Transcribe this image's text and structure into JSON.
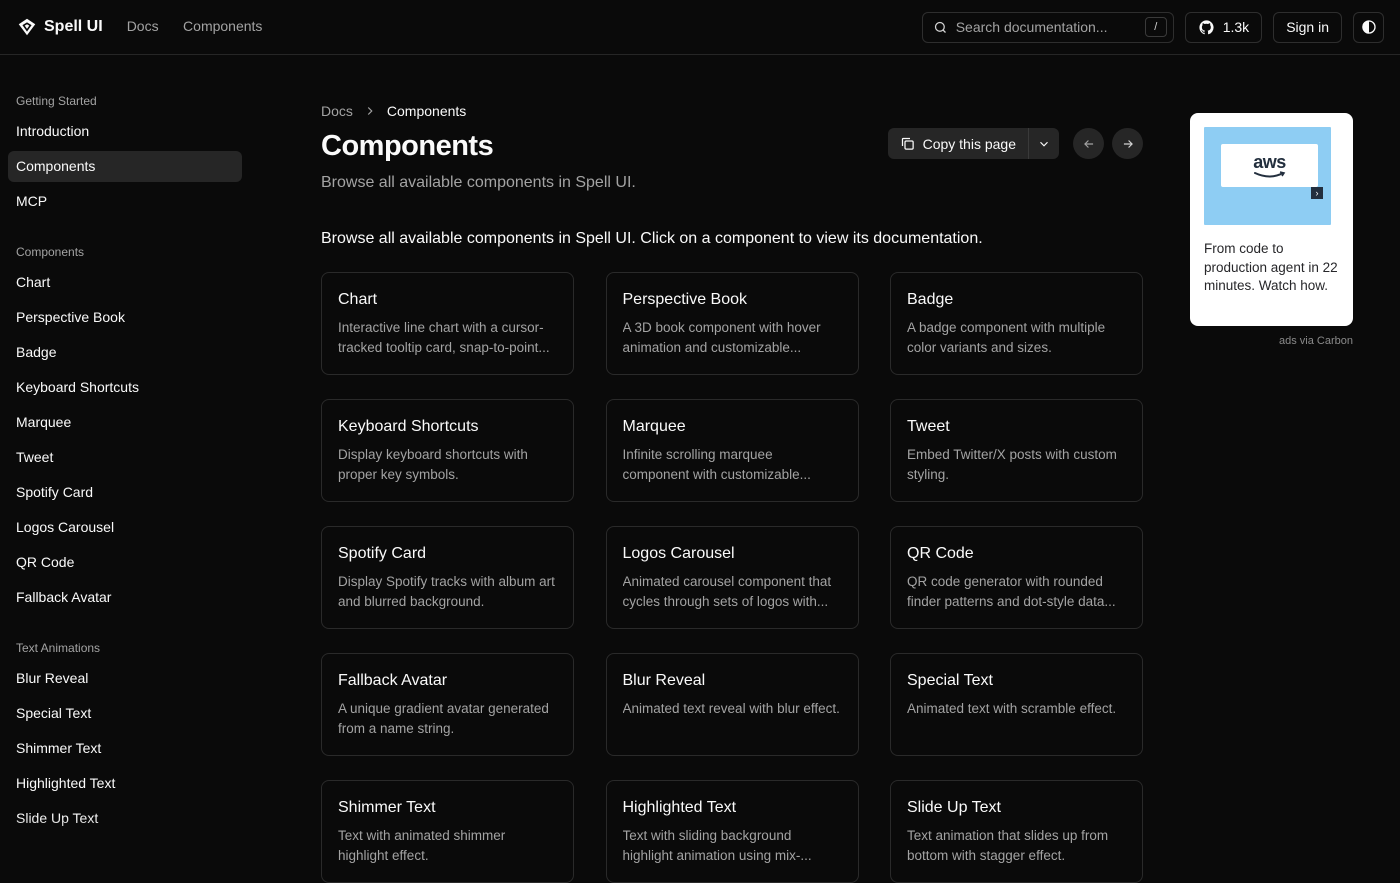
{
  "header": {
    "brand": "Spell UI",
    "nav": [
      "Docs",
      "Components"
    ],
    "search_placeholder": "Search documentation...",
    "search_shortcut": "/",
    "github_stars": "1.3k",
    "signin_label": "Sign in"
  },
  "sidebar": {
    "groups": [
      {
        "title": "Getting Started",
        "items": [
          "Introduction",
          "Components",
          "MCP"
        ]
      },
      {
        "title": "Components",
        "items": [
          "Chart",
          "Perspective Book",
          "Badge",
          "Keyboard Shortcuts",
          "Marquee",
          "Tweet",
          "Spotify Card",
          "Logos Carousel",
          "QR Code",
          "Fallback Avatar"
        ]
      },
      {
        "title": "Text Animations",
        "items": [
          "Blur Reveal",
          "Special Text",
          "Shimmer Text",
          "Highlighted Text",
          "Slide Up Text"
        ]
      }
    ],
    "active_item": "Components"
  },
  "breadcrumb": [
    "Docs",
    "Components"
  ],
  "page": {
    "title": "Components",
    "subtitle": "Browse all available components in Spell UI.",
    "copy_label": "Copy this page",
    "intro": "Browse all available components in Spell UI. Click on a component to view its documentation."
  },
  "cards": [
    {
      "title": "Chart",
      "desc": "Interactive line chart with a cursor-tracked tooltip card, snap-to-point..."
    },
    {
      "title": "Perspective Book",
      "desc": "A 3D book component with hover animation and customizable..."
    },
    {
      "title": "Badge",
      "desc": "A badge component with multiple color variants and sizes."
    },
    {
      "title": "Keyboard Shortcuts",
      "desc": "Display keyboard shortcuts with proper key symbols."
    },
    {
      "title": "Marquee",
      "desc": "Infinite scrolling marquee component with customizable..."
    },
    {
      "title": "Tweet",
      "desc": "Embed Twitter/X posts with custom styling."
    },
    {
      "title": "Spotify Card",
      "desc": "Display Spotify tracks with album art and blurred background."
    },
    {
      "title": "Logos Carousel",
      "desc": "Animated carousel component that cycles through sets of logos with..."
    },
    {
      "title": "QR Code",
      "desc": "QR code generator with rounded finder patterns and dot-style data..."
    },
    {
      "title": "Fallback Avatar",
      "desc": "A unique gradient avatar generated from a name string."
    },
    {
      "title": "Blur Reveal",
      "desc": "Animated text reveal with blur effect."
    },
    {
      "title": "Special Text",
      "desc": "Animated text with scramble effect."
    },
    {
      "title": "Shimmer Text",
      "desc": "Text with animated shimmer highlight effect."
    },
    {
      "title": "Highlighted Text",
      "desc": "Text with sliding background highlight animation using mix-..."
    },
    {
      "title": "Slide Up Text",
      "desc": "Text animation that slides up from bottom with stagger effect."
    }
  ],
  "ad": {
    "logo_text": "aws",
    "text": "From code to production agent in 22 minutes. Watch how.",
    "via": "ads via Carbon"
  },
  "icons": {
    "logo": "spell-ui-logo-icon",
    "search": "search-icon",
    "github": "github-icon",
    "theme": "moon-icon",
    "copy": "copy-icon",
    "chevron": "chevron-down-icon",
    "prev": "arrow-left-icon",
    "next": "arrow-right-icon"
  }
}
